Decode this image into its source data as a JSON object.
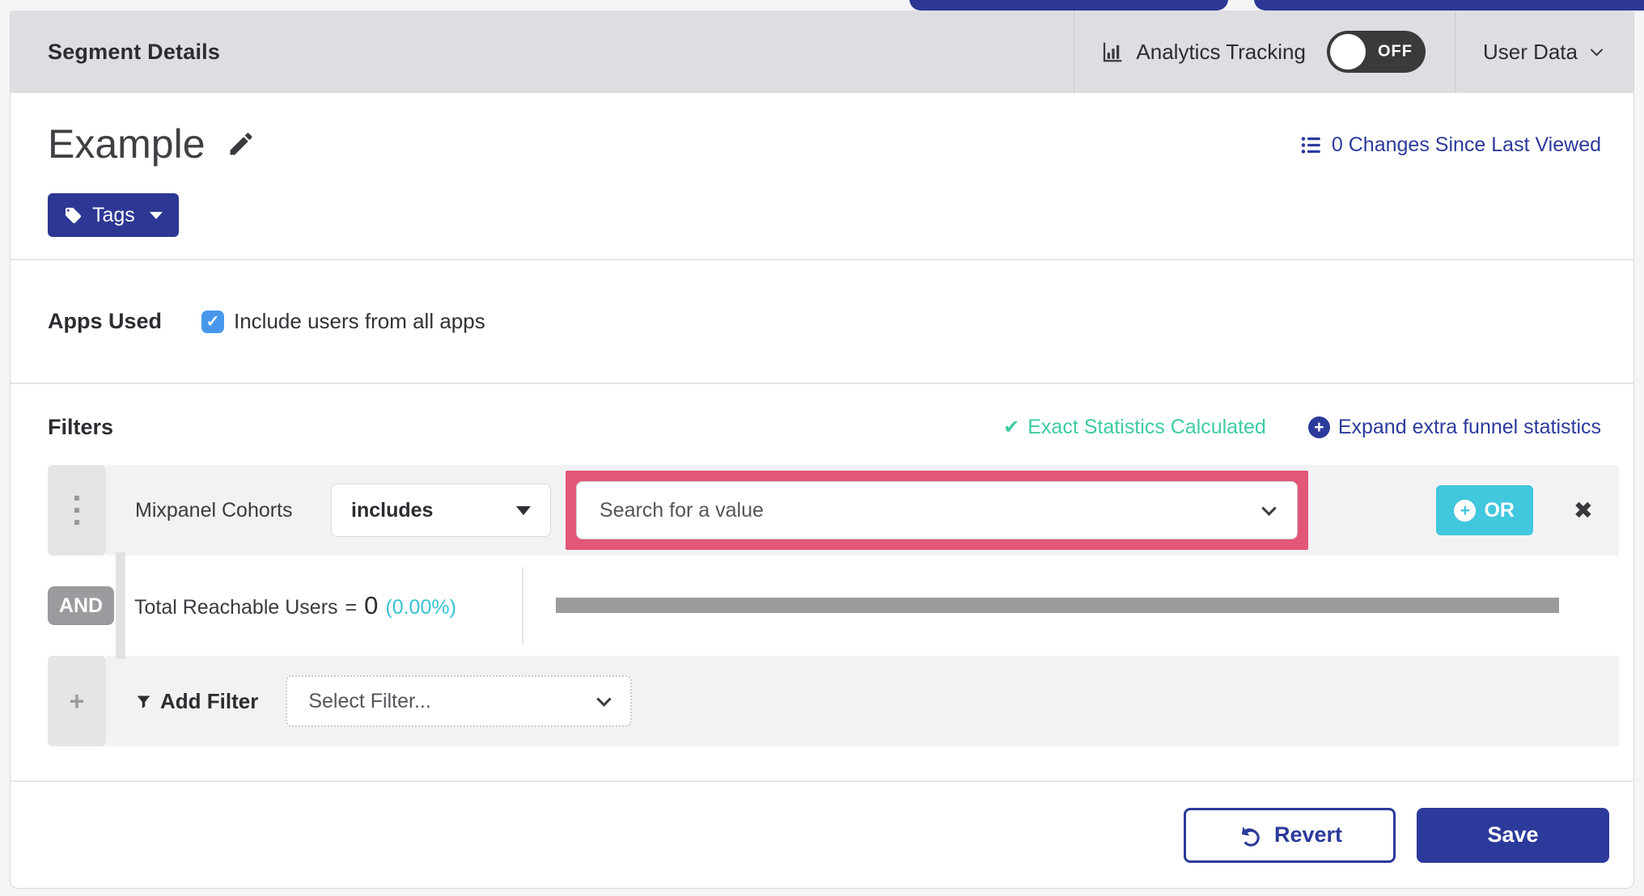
{
  "header": {
    "title": "Segment Details",
    "analytics": {
      "label": "Analytics Tracking",
      "toggle_state": "OFF"
    },
    "user_data": {
      "label": "User Data"
    }
  },
  "segment": {
    "name": "Example",
    "changes_link": "0 Changes Since Last Viewed",
    "tags_button": "Tags"
  },
  "apps_used": {
    "label": "Apps Used",
    "checkbox_label": "Include users from all apps",
    "checkbox_checked": true
  },
  "filters": {
    "title": "Filters",
    "status": "Exact Statistics Calculated",
    "expand_link": "Expand extra funnel statistics",
    "filter_row": {
      "field": "Mixpanel Cohorts",
      "operator": "includes",
      "value_placeholder": "Search for a value",
      "or_button": "OR"
    },
    "summary": {
      "and_label": "AND",
      "label": "Total Reachable Users",
      "equals": "=",
      "value": "0",
      "percent": "(0.00%)"
    },
    "add_filter": {
      "label": "Add Filter",
      "placeholder": "Select Filter..."
    }
  },
  "footer": {
    "revert": "Revert",
    "save": "Save"
  },
  "icons": {
    "close": "✖",
    "checkbox_check": "✓",
    "status_check": "✔",
    "plus": "+"
  },
  "colors": {
    "brand_blue": "#2d3794",
    "link_blue": "#2c3a9b",
    "status_teal": "#3ecba4",
    "percent_cyan": "#38c2d2",
    "or_teal": "#41c7de",
    "highlight_pink": "#e25677",
    "checkbox_blue": "#4798ec",
    "toggle_dark": "#3a3a3c"
  }
}
